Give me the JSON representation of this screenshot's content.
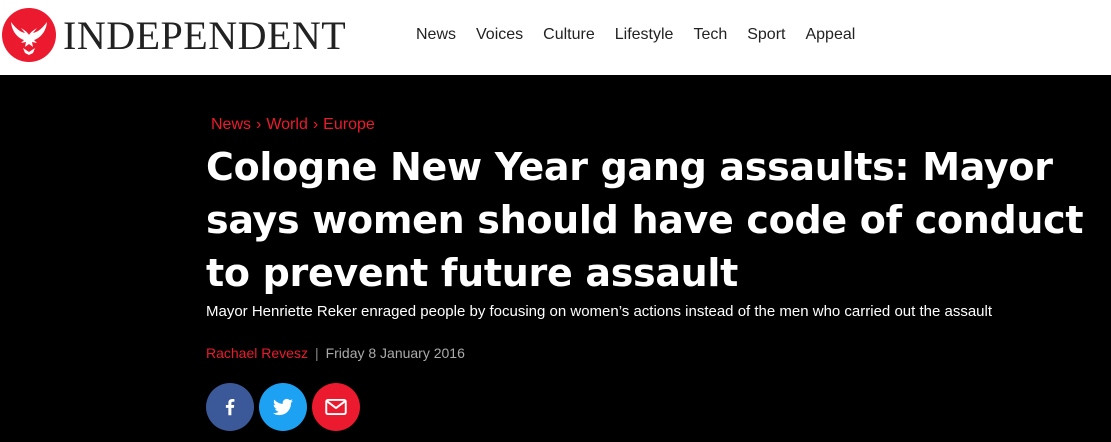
{
  "header": {
    "logo_text": "INDEPENDENT",
    "logo_icon": "eagle-icon",
    "nav": [
      "News",
      "Voices",
      "Culture",
      "Lifestyle",
      "Tech",
      "Sport",
      "Appeal"
    ]
  },
  "article": {
    "breadcrumb": [
      "News",
      "World",
      "Europe"
    ],
    "breadcrumb_sep": "›",
    "headline": "Cologne New Year gang assaults: Mayor says women should have code of conduct to prevent future assault",
    "standfirst": "Mayor Henriette Reker enraged people by focusing on women’s actions instead of the men who carried out the assault",
    "author": "Rachael Revesz",
    "byline_divider": "|",
    "date": "Friday 8 January 2016"
  },
  "share": [
    {
      "name": "facebook",
      "icon": "facebook-icon"
    },
    {
      "name": "twitter",
      "icon": "twitter-icon"
    },
    {
      "name": "email",
      "icon": "email-icon"
    }
  ],
  "colors": {
    "brand_red": "#ec1a2e",
    "facebook": "#3b5998",
    "twitter": "#1da1f2",
    "background": "#000000"
  }
}
